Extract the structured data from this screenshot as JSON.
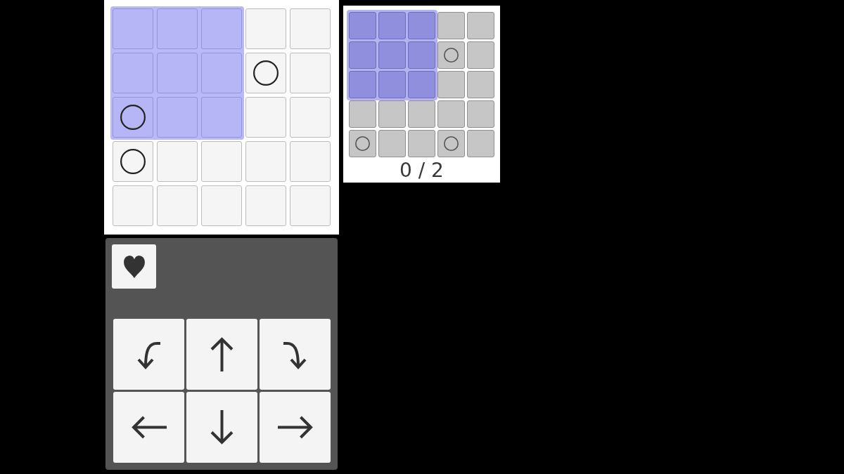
{
  "board": {
    "rows": [
      {
        "cells": [
          {
            "selected": true,
            "ring": false
          },
          {
            "selected": true,
            "ring": false
          },
          {
            "selected": true,
            "ring": false
          },
          {
            "selected": false,
            "ring": false
          },
          {
            "selected": false,
            "ring": false
          }
        ]
      },
      {
        "cells": [
          {
            "selected": true,
            "ring": false
          },
          {
            "selected": true,
            "ring": false
          },
          {
            "selected": true,
            "ring": false
          },
          {
            "selected": false,
            "ring": true
          },
          {
            "selected": false,
            "ring": false
          }
        ]
      },
      {
        "cells": [
          {
            "selected": true,
            "ring": true
          },
          {
            "selected": true,
            "ring": false
          },
          {
            "selected": true,
            "ring": false
          },
          {
            "selected": false,
            "ring": false
          },
          {
            "selected": false,
            "ring": false
          }
        ]
      },
      {
        "cells": [
          {
            "selected": false,
            "ring": true
          },
          {
            "selected": false,
            "ring": false
          },
          {
            "selected": false,
            "ring": false
          },
          {
            "selected": false,
            "ring": false
          },
          {
            "selected": false,
            "ring": false
          }
        ]
      },
      {
        "cells": [
          {
            "selected": false,
            "ring": false
          },
          {
            "selected": false,
            "ring": false
          },
          {
            "selected": false,
            "ring": false
          },
          {
            "selected": false,
            "ring": false
          },
          {
            "selected": false,
            "ring": false
          }
        ]
      }
    ]
  },
  "mini_board": {
    "rows": [
      {
        "cells": [
          {
            "selected": true,
            "ring": false
          },
          {
            "selected": true,
            "ring": false
          },
          {
            "selected": true,
            "ring": false
          },
          {
            "selected": false,
            "ring": false
          },
          {
            "selected": false,
            "ring": false
          }
        ]
      },
      {
        "cells": [
          {
            "selected": true,
            "ring": false
          },
          {
            "selected": true,
            "ring": false
          },
          {
            "selected": true,
            "ring": false
          },
          {
            "selected": false,
            "ring": true
          },
          {
            "selected": false,
            "ring": false
          }
        ]
      },
      {
        "cells": [
          {
            "selected": true,
            "ring": false
          },
          {
            "selected": true,
            "ring": false
          },
          {
            "selected": true,
            "ring": false
          },
          {
            "selected": false,
            "ring": false
          },
          {
            "selected": false,
            "ring": false
          }
        ]
      },
      {
        "cells": [
          {
            "selected": false,
            "ring": false
          },
          {
            "selected": false,
            "ring": false
          },
          {
            "selected": false,
            "ring": false
          },
          {
            "selected": false,
            "ring": false
          },
          {
            "selected": false,
            "ring": false
          }
        ]
      },
      {
        "cells": [
          {
            "selected": false,
            "ring": true
          },
          {
            "selected": false,
            "ring": false
          },
          {
            "selected": false,
            "ring": false
          },
          {
            "selected": false,
            "ring": true
          },
          {
            "selected": false,
            "ring": false
          }
        ]
      }
    ],
    "counter": "0 / 2"
  },
  "controls": {
    "action_buttons": [
      {
        "kind": "heart"
      }
    ],
    "move_buttons": [
      {
        "kind": "curve_left"
      },
      {
        "kind": "up"
      },
      {
        "kind": "curve_right"
      },
      {
        "kind": "left"
      },
      {
        "kind": "down"
      },
      {
        "kind": "right"
      }
    ]
  }
}
